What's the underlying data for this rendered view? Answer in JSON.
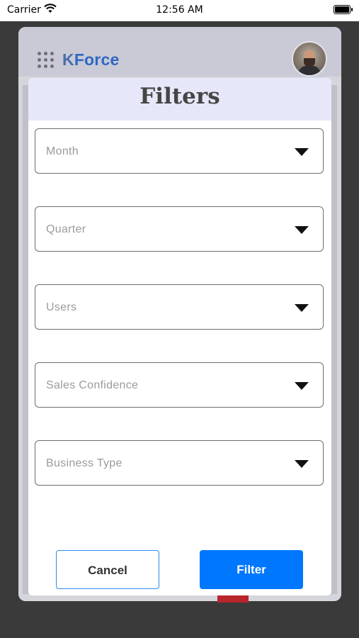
{
  "status_bar": {
    "carrier": "Carrier",
    "time": "12:56 AM",
    "wifi_icon": "wifi-icon",
    "battery_icon": "battery-icon"
  },
  "app": {
    "brand_k": "K",
    "brand_rest": "Force",
    "menu_icon": "grid-menu-icon",
    "brand_color": "#2f67c4"
  },
  "modal": {
    "title": "Filters",
    "fields": [
      {
        "placeholder": "Month"
      },
      {
        "placeholder": "Quarter"
      },
      {
        "placeholder": "Users"
      },
      {
        "placeholder": "Sales Confidence"
      },
      {
        "placeholder": "Business Type"
      }
    ],
    "cancel_label": "Cancel",
    "filter_label": "Filter",
    "primary_color": "#0077ff"
  }
}
